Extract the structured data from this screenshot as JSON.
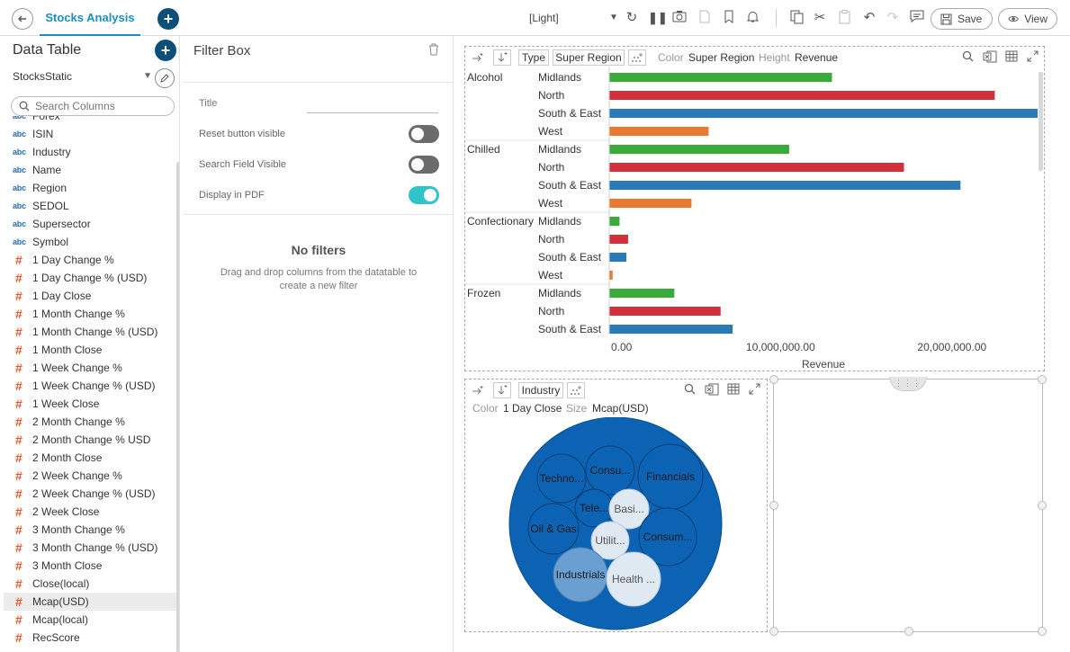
{
  "topbar": {
    "tab_title": "Stocks Analysis",
    "theme_label": "[Light]",
    "save_label": "Save",
    "view_label": "View"
  },
  "left_panel": {
    "title": "Data Table",
    "datatable_name": "StocksStatic",
    "search_placeholder": "Search Columns",
    "columns": [
      {
        "type": "text",
        "name": "Forex"
      },
      {
        "type": "text",
        "name": "ISIN"
      },
      {
        "type": "text",
        "name": "Industry"
      },
      {
        "type": "text",
        "name": "Name"
      },
      {
        "type": "text",
        "name": "Region"
      },
      {
        "type": "text",
        "name": "SEDOL"
      },
      {
        "type": "text",
        "name": "Supersector"
      },
      {
        "type": "text",
        "name": "Symbol"
      },
      {
        "type": "number",
        "name": "1 Day Change %"
      },
      {
        "type": "number",
        "name": "1 Day Change % (USD)"
      },
      {
        "type": "number",
        "name": "1 Day Close"
      },
      {
        "type": "number",
        "name": "1 Month Change %"
      },
      {
        "type": "number",
        "name": "1 Month Change % (USD)"
      },
      {
        "type": "number",
        "name": "1 Month Close"
      },
      {
        "type": "number",
        "name": "1 Week Change %"
      },
      {
        "type": "number",
        "name": "1 Week Change % (USD)"
      },
      {
        "type": "number",
        "name": "1 Week Close"
      },
      {
        "type": "number",
        "name": "2 Month Change %"
      },
      {
        "type": "number",
        "name": "2 Month Change % USD"
      },
      {
        "type": "number",
        "name": "2 Month Close"
      },
      {
        "type": "number",
        "name": "2 Week Change %"
      },
      {
        "type": "number",
        "name": "2 Week Change % (USD)"
      },
      {
        "type": "number",
        "name": "2 Week Close"
      },
      {
        "type": "number",
        "name": "3 Month Change %"
      },
      {
        "type": "number",
        "name": "3 Month Change % (USD)"
      },
      {
        "type": "number",
        "name": "3 Month Close"
      },
      {
        "type": "number",
        "name": "Close(local)"
      },
      {
        "type": "number",
        "name": "Mcap(USD)",
        "selected": true
      },
      {
        "type": "number",
        "name": "Mcap(local)"
      },
      {
        "type": "number",
        "name": "RecScore"
      }
    ],
    "text_type_label": "abc",
    "number_type_label": "#"
  },
  "filter_box": {
    "title": "Filter Box",
    "title_label": "Title",
    "title_value": "",
    "settings": [
      {
        "label": "Reset button visible",
        "on": false
      },
      {
        "label": "Search Field Visible",
        "on": false
      },
      {
        "label": "Display in PDF",
        "on": true
      }
    ],
    "empty_title": "No filters",
    "empty_text": "Drag and drop columns from the datatable to create a new filter"
  },
  "bar_panel": {
    "type_label": "Type",
    "type_value": "Super Region",
    "color_label": "Color",
    "color_value": "Super Region",
    "height_label": "Height",
    "height_value": "Revenue"
  },
  "chart_data": {
    "type": "bar",
    "orientation": "horizontal",
    "xlabel": "Revenue",
    "xticks": [
      "0.00",
      "10,000,000.00",
      "20,000,000.00"
    ],
    "xlim": [
      0,
      25000000
    ],
    "groups": [
      {
        "name": "Alcohol",
        "bars": [
          {
            "region": "Midlands",
            "value": 13000000
          },
          {
            "region": "North",
            "value": 22500000
          },
          {
            "region": "South & East",
            "value": 25000000
          },
          {
            "region": "West",
            "value": 5800000
          }
        ]
      },
      {
        "name": "Chilled",
        "bars": [
          {
            "region": "Midlands",
            "value": 10500000
          },
          {
            "region": "North",
            "value": 17200000
          },
          {
            "region": "South & East",
            "value": 20500000
          },
          {
            "region": "West",
            "value": 4800000
          }
        ]
      },
      {
        "name": "Confectionary",
        "bars": [
          {
            "region": "Midlands",
            "value": 600000
          },
          {
            "region": "North",
            "value": 1100000
          },
          {
            "region": "South & East",
            "value": 1000000
          },
          {
            "region": "West",
            "value": 200000
          }
        ]
      },
      {
        "name": "Frozen",
        "bars": [
          {
            "region": "Midlands",
            "value": 3800000
          },
          {
            "region": "North",
            "value": 6500000
          },
          {
            "region": "South & East",
            "value": 7200000
          }
        ]
      }
    ],
    "colors": {
      "Midlands": "#3aaa3a",
      "North": "#d1303a",
      "South & East": "#2a7ab8",
      "West": "#e87b30"
    }
  },
  "bubble_panel": {
    "type_value": "Industry",
    "color_label": "Color",
    "color_value": "1 Day Close",
    "size_label": "Size",
    "size_value": "Mcap(USD)",
    "bubbles": [
      {
        "label": "Techno...",
        "light": false
      },
      {
        "label": "Consu...",
        "light": false
      },
      {
        "label": "Financials",
        "light": false
      },
      {
        "label": "Tele...",
        "light": false
      },
      {
        "label": "Basi...",
        "light": true
      },
      {
        "label": "Oil & Gas",
        "light": false
      },
      {
        "label": "Utilit...",
        "light": true
      },
      {
        "label": "Consum...",
        "light": false
      },
      {
        "label": "Industrials",
        "light": "mid"
      },
      {
        "label": "Health ...",
        "light": true
      }
    ]
  }
}
